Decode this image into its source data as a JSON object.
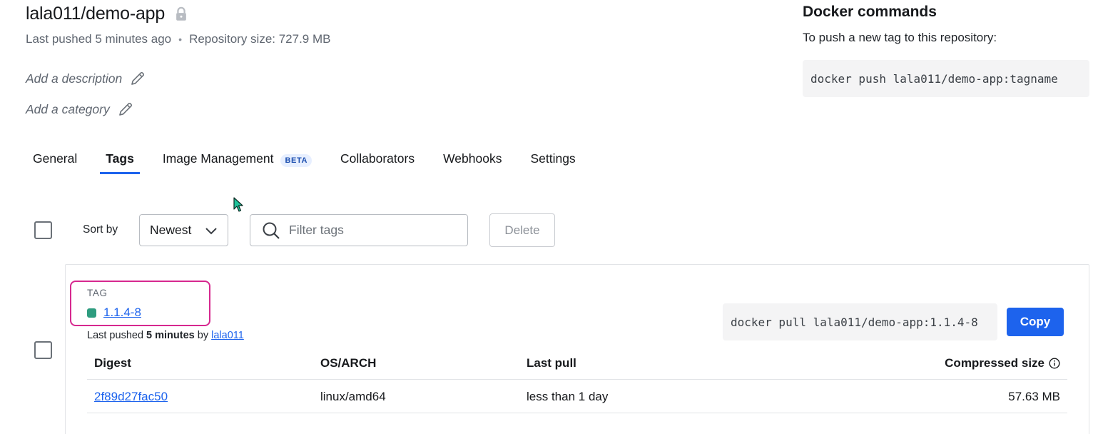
{
  "repo": {
    "name": "lala011/demo-app",
    "last_pushed": "Last pushed 5 minutes ago",
    "size": "Repository size: 727.9 MB",
    "add_description": "Add a description",
    "add_category": "Add a category"
  },
  "docker_commands": {
    "title": "Docker commands",
    "subtitle": "To push a new tag to this repository:",
    "push_command": "docker push lala011/demo-app:tagname"
  },
  "tabs": [
    {
      "label": "General",
      "active": false
    },
    {
      "label": "Tags",
      "active": true
    },
    {
      "label": "Image Management",
      "active": false,
      "badge": "BETA"
    },
    {
      "label": "Collaborators",
      "active": false
    },
    {
      "label": "Webhooks",
      "active": false
    },
    {
      "label": "Settings",
      "active": false
    }
  ],
  "toolbar": {
    "sort_label": "Sort by",
    "sort_value": "Newest",
    "filter_placeholder": "Filter tags",
    "delete_label": "Delete"
  },
  "tag_card": {
    "section_label": "TAG",
    "tag_name": "1.1.4-8",
    "pushed_prefix": "Last pushed",
    "pushed_time": "5 minutes",
    "pushed_by": "by",
    "pushed_user": "lala011",
    "pull_command": "docker pull lala011/demo-app:1.1.4-8",
    "copy_label": "Copy",
    "columns": {
      "digest": "Digest",
      "os_arch": "OS/ARCH",
      "last_pull": "Last pull",
      "compressed_size": "Compressed size"
    },
    "rows": [
      {
        "digest": "2f89d27fac50",
        "os_arch": "linux/amd64",
        "last_pull": "less than 1 day",
        "compressed_size": "57.63 MB"
      }
    ]
  },
  "colors": {
    "accent": "#1d63ed",
    "tag_status": "#2e9c7f",
    "highlight": "#d6288f"
  }
}
